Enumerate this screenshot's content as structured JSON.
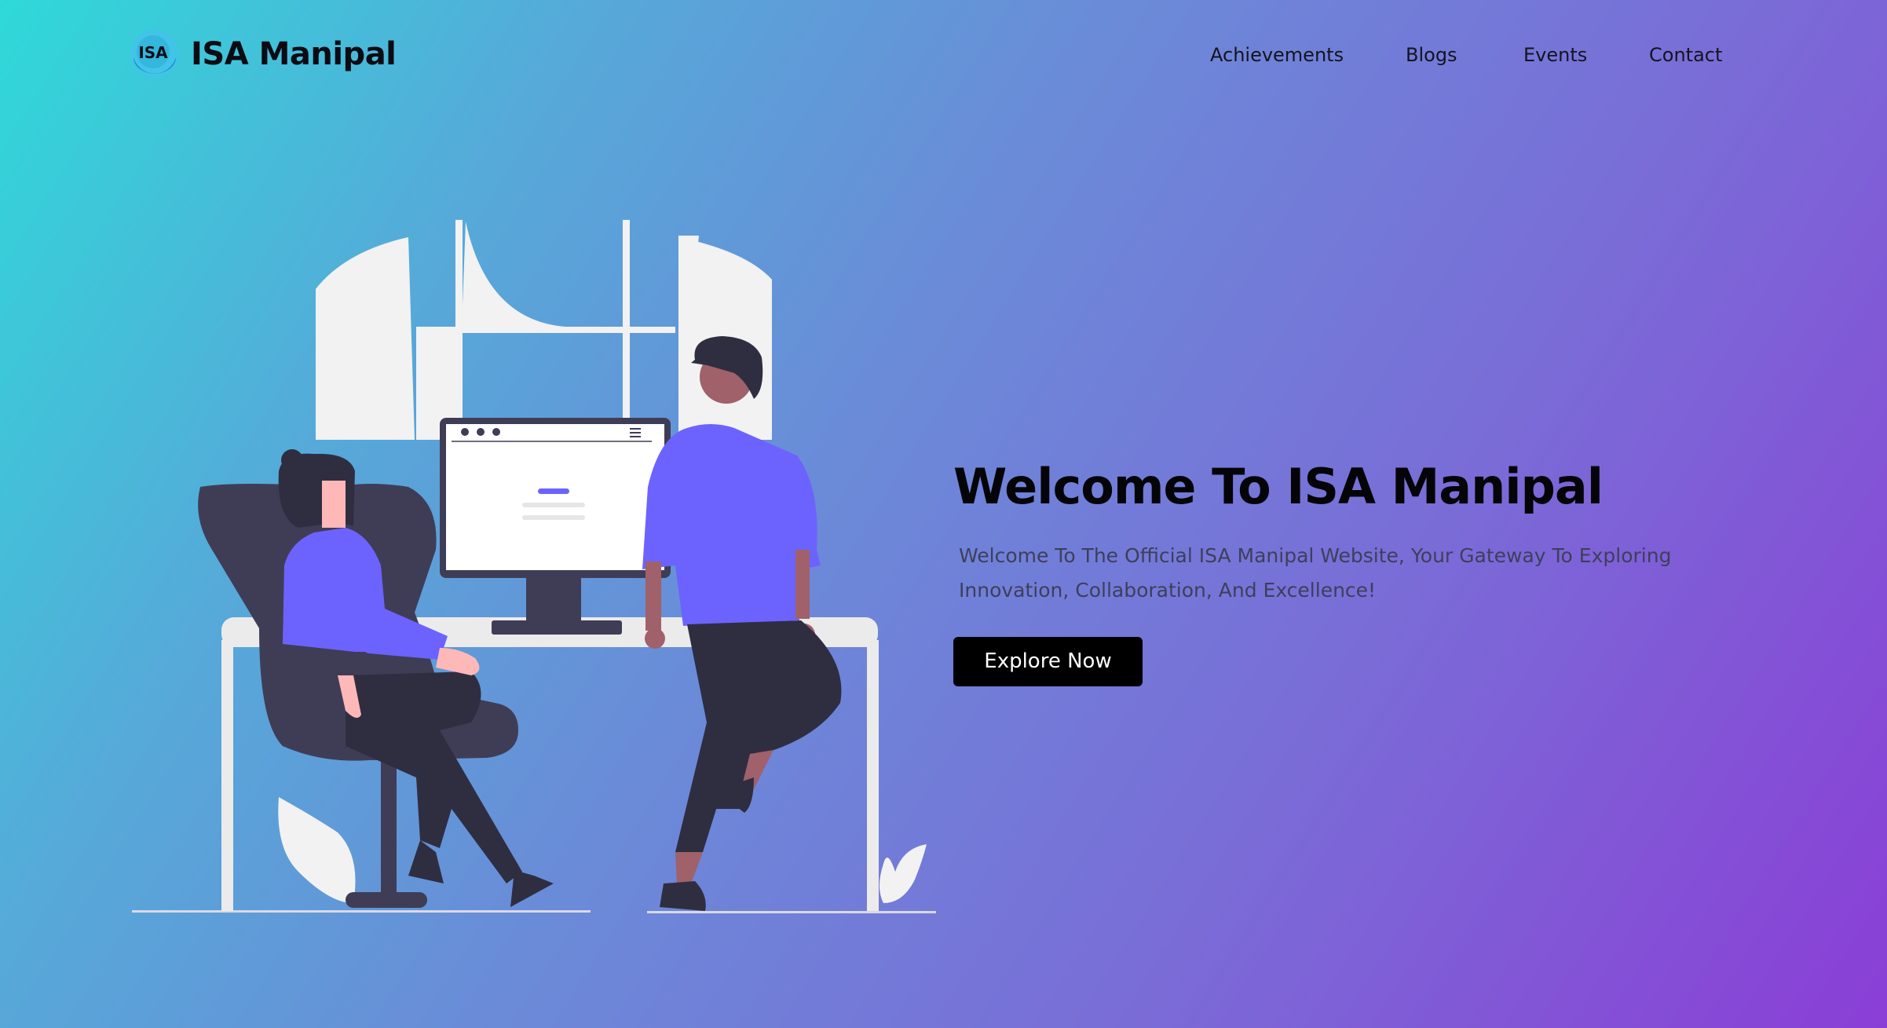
{
  "header": {
    "logo_text": "ISA",
    "brand": "ISA Manipal"
  },
  "nav": {
    "items": [
      {
        "label": "Achievements"
      },
      {
        "label": "Blogs"
      },
      {
        "label": "Events"
      },
      {
        "label": "Contact"
      }
    ]
  },
  "hero": {
    "title": "Welcome To ISA Manipal",
    "subtitle": "Welcome To The Official ISA Manipal Website, Your Gateway To Exploring Innovation, Collaboration, And Excellence!",
    "cta_label": "Explore Now"
  },
  "colors": {
    "gradient_start": "#2ed9d9",
    "gradient_end": "#8a3ed6",
    "button_bg": "#000000",
    "illustration_accent": "#6c63ff",
    "illustration_dark": "#3f3d56"
  },
  "icons": {
    "logo": "isa-logo-icon"
  }
}
